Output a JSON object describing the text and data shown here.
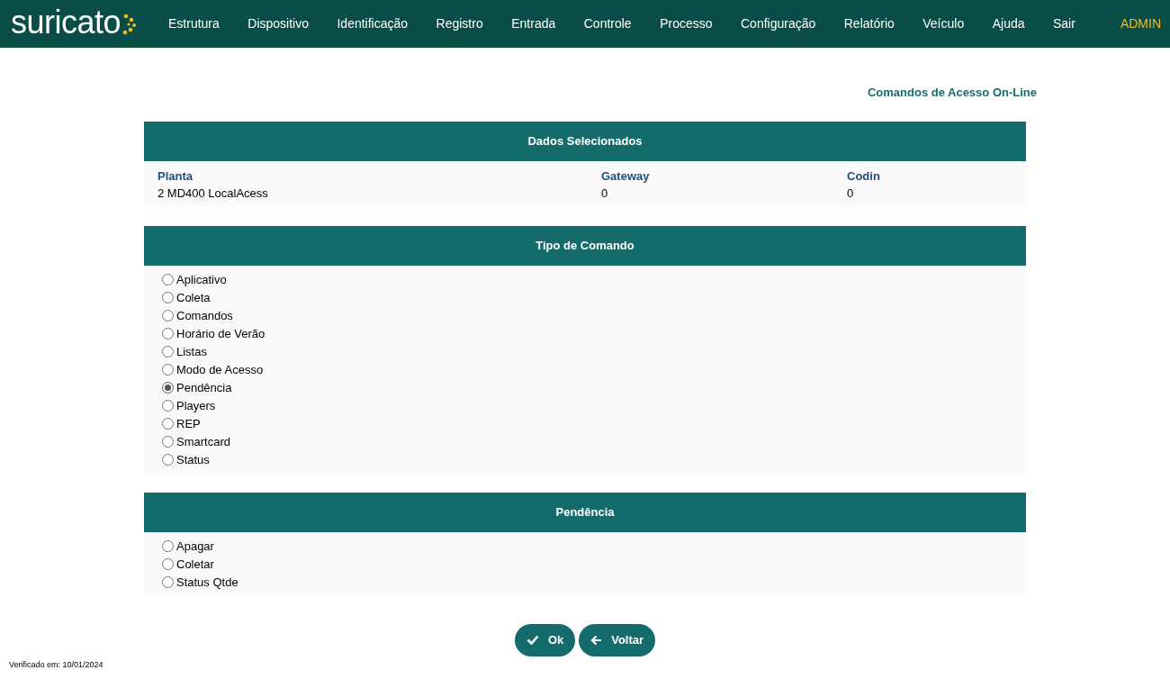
{
  "header": {
    "logo": "suricato",
    "menu": [
      "Estrutura",
      "Dispositivo",
      "Identificação",
      "Registro",
      "Entrada",
      "Controle",
      "Processo",
      "Configuração",
      "Relatório",
      "Veículo",
      "Ajuda",
      "Sair"
    ],
    "user": "ADMIN"
  },
  "page_title": "Comandos de Acesso On-Line",
  "selected_data": {
    "title": "Dados Selecionados",
    "fields": [
      {
        "label": "Planta",
        "value": "2 MD400 LocalAcess"
      },
      {
        "label": "Gateway",
        "value": "0"
      },
      {
        "label": "Codin",
        "value": "0"
      }
    ]
  },
  "command_type": {
    "title": "Tipo de Comando",
    "options": [
      {
        "label": "Aplicativo",
        "selected": false
      },
      {
        "label": "Coleta",
        "selected": false
      },
      {
        "label": "Comandos",
        "selected": false
      },
      {
        "label": "Horário de Verão",
        "selected": false
      },
      {
        "label": "Listas",
        "selected": false
      },
      {
        "label": "Modo de Acesso",
        "selected": false
      },
      {
        "label": "Pendência",
        "selected": true
      },
      {
        "label": "Players",
        "selected": false
      },
      {
        "label": "REP",
        "selected": false
      },
      {
        "label": "Smartcard",
        "selected": false
      },
      {
        "label": "Status",
        "selected": false
      }
    ]
  },
  "pending": {
    "title": "Pendência",
    "options": [
      {
        "label": "Apagar",
        "selected": false
      },
      {
        "label": "Coletar",
        "selected": false
      },
      {
        "label": "Status Qtde",
        "selected": false
      }
    ]
  },
  "buttons": [
    {
      "kind": "ok",
      "label": "Ok"
    },
    {
      "kind": "back",
      "label": "Voltar"
    }
  ],
  "footer": "Verificado em: 10/01/2024"
}
